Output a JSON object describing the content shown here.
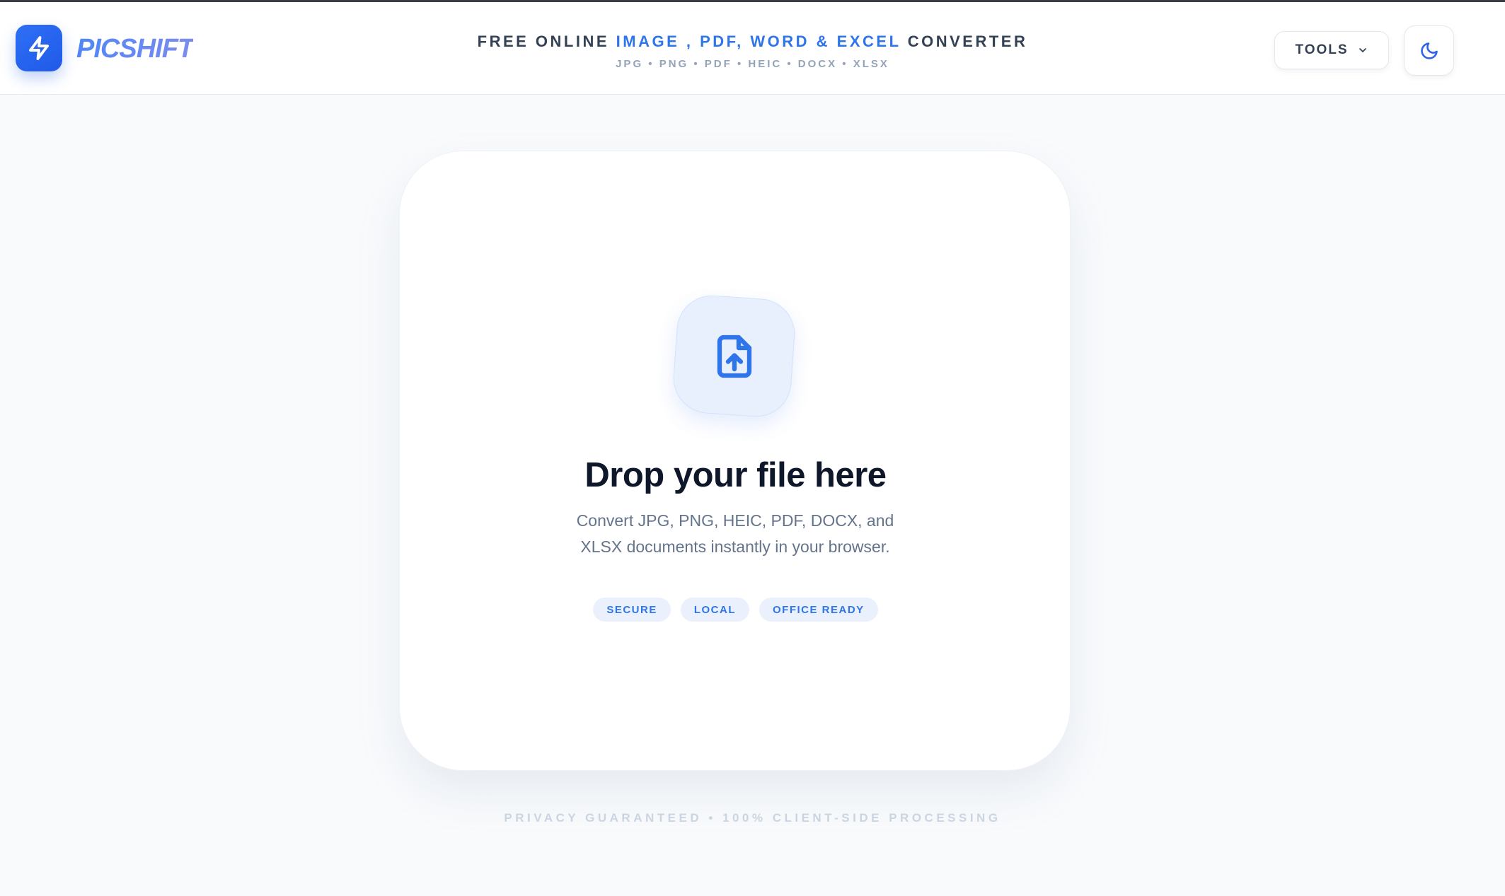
{
  "brand": {
    "name": "PICSHIFT",
    "logo_icon": "lightning-bolt-icon"
  },
  "header": {
    "tagline_prefix": "FREE ONLINE",
    "tagline_accent": "IMAGE , PDF, WORD & EXCEL",
    "tagline_suffix": "CONVERTER",
    "formats": "JPG • PNG • PDF • HEIC • DOCX • XLSX",
    "tools_label": "TOOLS",
    "tools_icon": "chevron-down-icon",
    "theme_icon": "moon-icon"
  },
  "dropzone": {
    "icon": "file-upload-icon",
    "title": "Drop your file here",
    "description": "Convert JPG, PNG, HEIC, PDF, DOCX, and XLSX documents instantly in your browser.",
    "badges": [
      "SECURE",
      "LOCAL",
      "OFFICE READY"
    ]
  },
  "footer": {
    "note": "PRIVACY GUARANTEED • 100% CLIENT-SIDE PROCESSING"
  },
  "colors": {
    "accent": "#2f75ea",
    "brand_blue": "#1f5ae8",
    "heading": "#0f172a",
    "muted": "#64748b",
    "page_background": "#f8fafc"
  }
}
